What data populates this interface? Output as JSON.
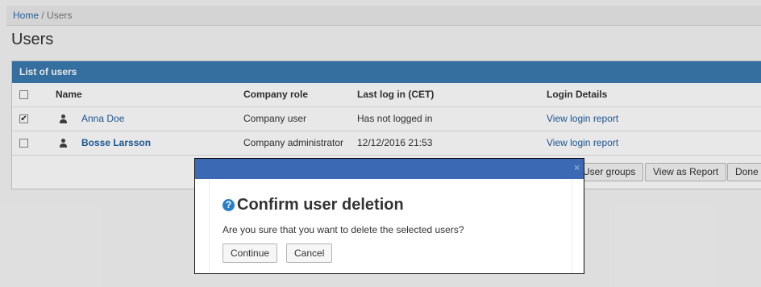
{
  "breadcrumb": {
    "home": "Home",
    "separator": "/",
    "current": "Users"
  },
  "page": {
    "title": "Users"
  },
  "panel": {
    "heading": "List of users"
  },
  "table": {
    "columns": {
      "name": "Name",
      "role": "Company role",
      "last_login": "Last log in (CET)",
      "login_details": "Login Details"
    },
    "rows": [
      {
        "checked": true,
        "checkmark": "✔",
        "name": "Anna Doe",
        "name_bold": false,
        "role": "Company user",
        "last_login": "Has not logged in",
        "login_details": "View login report"
      },
      {
        "checked": false,
        "checkmark": "",
        "name": "Bosse Larsson",
        "name_bold": true,
        "role": "Company administrator",
        "last_login": "12/12/2016 21:53",
        "login_details": "View login report"
      }
    ]
  },
  "toolbar": {
    "user_groups": "User groups",
    "view_as_report": "View as Report",
    "done": "Done"
  },
  "dialog": {
    "close_glyph": "×",
    "question_glyph": "?",
    "title": "Confirm user deletion",
    "message": "Are you sure that you want to delete the selected users?",
    "continue_label": "Continue",
    "cancel_label": "Cancel"
  },
  "colors": {
    "panel_heading": "#3a7aaf",
    "dialog_titlebar": "#3b69b3",
    "link": "#1f5fa0",
    "question_icon": "#2a7fc4"
  }
}
